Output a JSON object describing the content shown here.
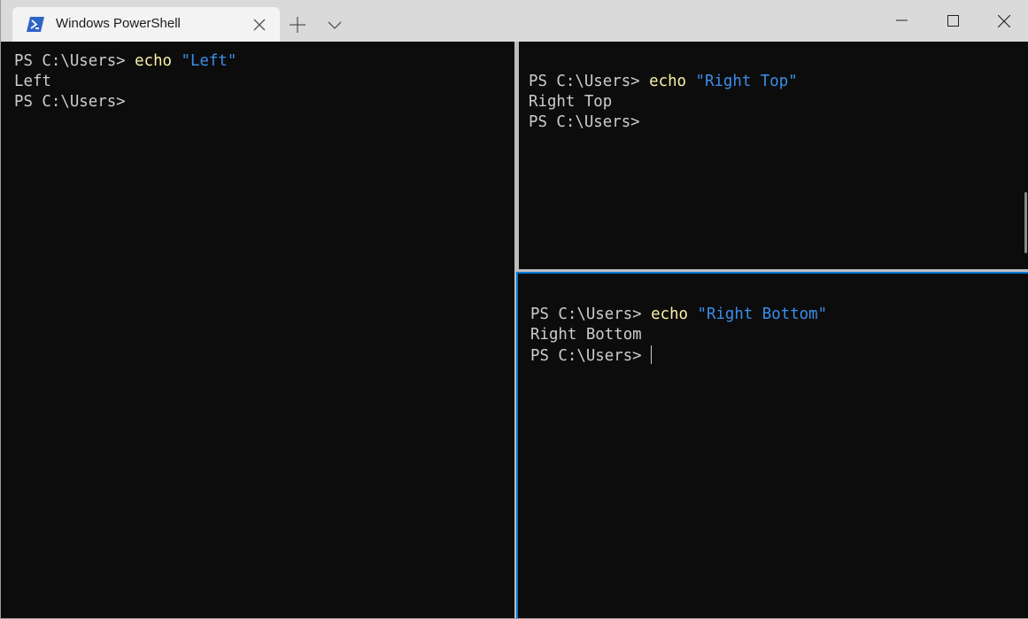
{
  "window": {
    "tab_title": "Windows PowerShell",
    "tab_icon": "powershell-icon",
    "accent_color": "#0078d4"
  },
  "panes": {
    "left": {
      "lines": [
        {
          "prompt": "PS C:\\Users> ",
          "cmd": "echo",
          "arg": "\"Left\""
        },
        {
          "output": "Left"
        },
        {
          "prompt": "PS C:\\Users>"
        }
      ]
    },
    "right_top": {
      "lines": [
        {
          "prompt": "PS C:\\Users> ",
          "cmd": "echo",
          "arg": "\"Right Top\""
        },
        {
          "output": "Right Top"
        },
        {
          "prompt": "PS C:\\Users>"
        }
      ]
    },
    "right_bottom": {
      "active": true,
      "lines": [
        {
          "prompt": "PS C:\\Users> ",
          "cmd": "echo",
          "arg": "\"Right Bottom\""
        },
        {
          "output": "Right Bottom"
        },
        {
          "prompt": "PS C:\\Users>"
        }
      ]
    }
  }
}
